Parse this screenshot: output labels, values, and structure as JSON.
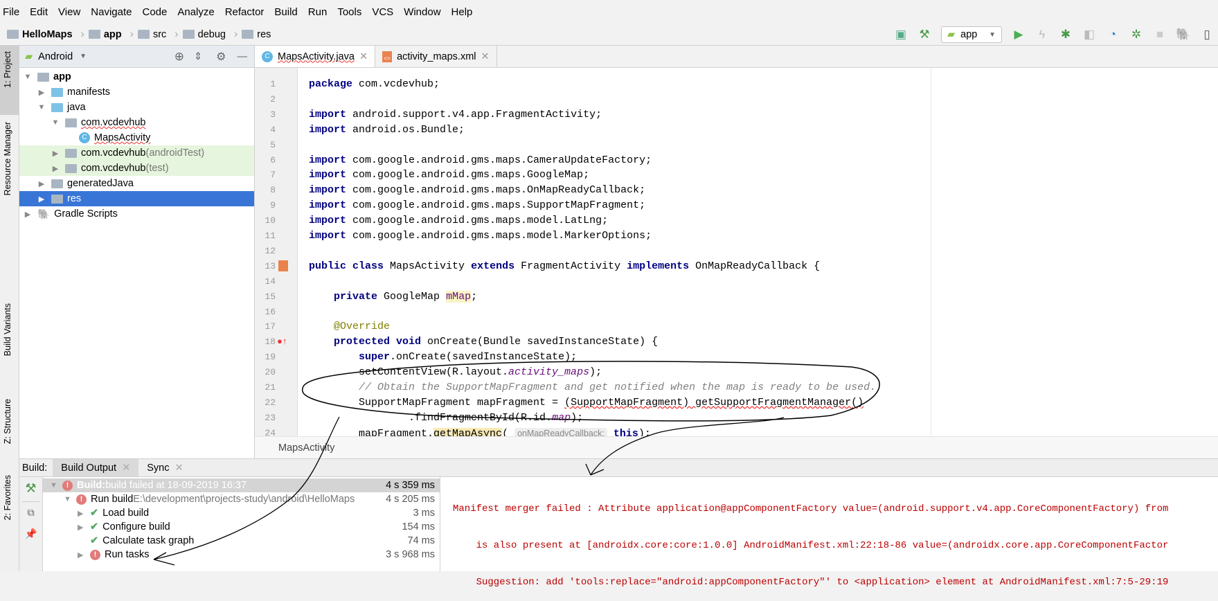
{
  "menu": [
    "File",
    "Edit",
    "View",
    "Navigate",
    "Code",
    "Analyze",
    "Refactor",
    "Build",
    "Run",
    "Tools",
    "VCS",
    "Window",
    "Help"
  ],
  "breadcrumb": [
    "HelloMaps",
    "app",
    "src",
    "debug",
    "res"
  ],
  "toolbar": {
    "run_config": "app"
  },
  "left_stripe": {
    "project": "1: Project",
    "resource_manager": "Resource Manager",
    "build_variants": "Build Variants",
    "structure": "Z: Structure",
    "favorites": "2: Favorites"
  },
  "project": {
    "view": "Android",
    "items": [
      {
        "label": "app",
        "suffix": "",
        "depth": 0,
        "open": true,
        "bold": true,
        "style": ""
      },
      {
        "label": "manifests",
        "suffix": "",
        "depth": 1,
        "open": false,
        "style": ""
      },
      {
        "label": "java",
        "suffix": "",
        "depth": 1,
        "open": true,
        "style": ""
      },
      {
        "label": "com.vcdevhub",
        "suffix": "",
        "depth": 2,
        "open": true,
        "style": ""
      },
      {
        "label": "MapsActivity",
        "suffix": "",
        "depth": 3,
        "leaf": true,
        "style": ""
      },
      {
        "label": "com.vcdevhub",
        "suffix": " (androidTest)",
        "depth": 2,
        "open": false,
        "style": "green"
      },
      {
        "label": "com.vcdevhub",
        "suffix": " (test)",
        "depth": 2,
        "open": false,
        "style": "green"
      },
      {
        "label": "generatedJava",
        "suffix": "",
        "depth": 1,
        "open": false,
        "style": ""
      },
      {
        "label": "res",
        "suffix": "",
        "depth": 1,
        "open": false,
        "style": "selected"
      },
      {
        "label": "Gradle Scripts",
        "suffix": "",
        "depth": 0,
        "open": false,
        "style": ""
      }
    ]
  },
  "editor": {
    "tabs": [
      {
        "label": "MapsActivity.java",
        "active": true
      },
      {
        "label": "activity_maps.xml",
        "active": false
      }
    ],
    "breadcrumb": "MapsActivity",
    "lines": [
      [
        [
          "package",
          "kw"
        ],
        [
          " com.vcdevhub;",
          ""
        ]
      ],
      [],
      [
        [
          "import",
          "kw"
        ],
        [
          " android.support.v4.app.FragmentActivity;",
          ""
        ]
      ],
      [
        [
          "import",
          "kw"
        ],
        [
          " android.os.Bundle;",
          ""
        ]
      ],
      [],
      [
        [
          "import",
          "kw"
        ],
        [
          " com.google.android.gms.maps.CameraUpdateFactory;",
          ""
        ]
      ],
      [
        [
          "import",
          "kw"
        ],
        [
          " com.google.android.gms.maps.GoogleMap;",
          ""
        ]
      ],
      [
        [
          "import",
          "kw"
        ],
        [
          " com.google.android.gms.maps.OnMapReadyCallback;",
          ""
        ]
      ],
      [
        [
          "import",
          "kw"
        ],
        [
          " com.google.android.gms.maps.SupportMapFragment;",
          ""
        ]
      ],
      [
        [
          "import",
          "kw"
        ],
        [
          " com.google.android.gms.maps.model.LatLng;",
          ""
        ]
      ],
      [
        [
          "import",
          "kw"
        ],
        [
          " com.google.android.gms.maps.model.MarkerOptions;",
          ""
        ]
      ],
      [],
      [
        [
          "public class",
          "kw"
        ],
        [
          " MapsActivity ",
          ""
        ],
        [
          "extends",
          "kw"
        ],
        [
          " FragmentActivity ",
          ""
        ],
        [
          "implements",
          "kw"
        ],
        [
          " OnMapReadyCallback {",
          ""
        ]
      ],
      [],
      [
        [
          "    ",
          ""
        ],
        [
          "private",
          "kw"
        ],
        [
          " GoogleMap ",
          ""
        ],
        [
          "mMap",
          "fldh"
        ],
        [
          ";",
          ""
        ]
      ],
      [],
      [
        [
          "    ",
          ""
        ],
        [
          "@Override",
          "ann"
        ]
      ],
      [
        [
          "    ",
          ""
        ],
        [
          "protected void",
          "kw"
        ],
        [
          " onCreate(Bundle savedInstanceState) {",
          ""
        ]
      ],
      [
        [
          "        ",
          ""
        ],
        [
          "super",
          "kw"
        ],
        [
          ".onCreate(savedInstanceState);",
          ""
        ]
      ],
      [
        [
          "        setContentView(R.layout.",
          ""
        ],
        [
          "activity_maps",
          "fld"
        ],
        [
          ");",
          ""
        ]
      ],
      [
        [
          "        ",
          ""
        ],
        [
          "// Obtain the SupportMapFragment and get notified when the map is ready to be used.",
          "cm"
        ]
      ],
      [
        [
          "        SupportMapFragment mapFragment = ",
          ""
        ],
        [
          "(SupportMapFragment) getSupportFragmentManager()",
          "err"
        ]
      ],
      [
        [
          "                .findFragmentById(R.id.",
          ""
        ],
        [
          "map",
          "fld"
        ],
        [
          ");",
          ""
        ]
      ],
      [
        [
          "        mapFragment.",
          ""
        ],
        [
          "getMapAsync",
          "hl"
        ],
        [
          "( ",
          ""
        ],
        [
          "onMapReadyCallback:",
          "hint"
        ],
        [
          " ",
          ""
        ],
        [
          "this",
          "kw"
        ],
        [
          ");",
          ""
        ]
      ],
      []
    ]
  },
  "build": {
    "label": "Build:",
    "tabs": [
      "Build Output",
      "Sync"
    ],
    "tree": [
      {
        "status": "error",
        "title": "Build:",
        "detail": " build failed at 18-09-2019 16:37",
        "time": "4 s 359 ms",
        "depth": 0,
        "expander": "open",
        "selected": true
      },
      {
        "status": "error",
        "title": "Run build",
        "detail": " E:\\development\\projects-study\\android\\HelloMaps",
        "time": "4 s 205 ms",
        "depth": 1,
        "expander": "open"
      },
      {
        "status": "ok",
        "title": "Load build",
        "detail": "",
        "time": "3 ms",
        "depth": 2,
        "expander": "closed"
      },
      {
        "status": "ok",
        "title": "Configure build",
        "detail": "",
        "time": "154 ms",
        "depth": 2,
        "expander": "closed"
      },
      {
        "status": "ok",
        "title": "Calculate task graph",
        "detail": "",
        "time": "74 ms",
        "depth": 2,
        "expander": "none"
      },
      {
        "status": "error",
        "title": "Run tasks",
        "detail": "",
        "time": "3 s 968 ms",
        "depth": 2,
        "expander": "closed"
      }
    ],
    "output": [
      "Manifest merger failed : Attribute application@appComponentFactory value=(android.support.v4.app.CoreComponentFactory) from",
      "    is also present at [androidx.core:core:1.0.0] AndroidManifest.xml:22:18-86 value=(androidx.core.app.CoreComponentFactor",
      "    Suggestion: add 'tools:replace=\"android:appComponentFactory\"' to <application> element at AndroidManifest.xml:7:5-29:19"
    ]
  },
  "colors": {
    "selection": "#3875d7",
    "error": "#e27a7a",
    "ok": "#59a869",
    "keyword": "#000080",
    "output_error": "#b00000"
  }
}
